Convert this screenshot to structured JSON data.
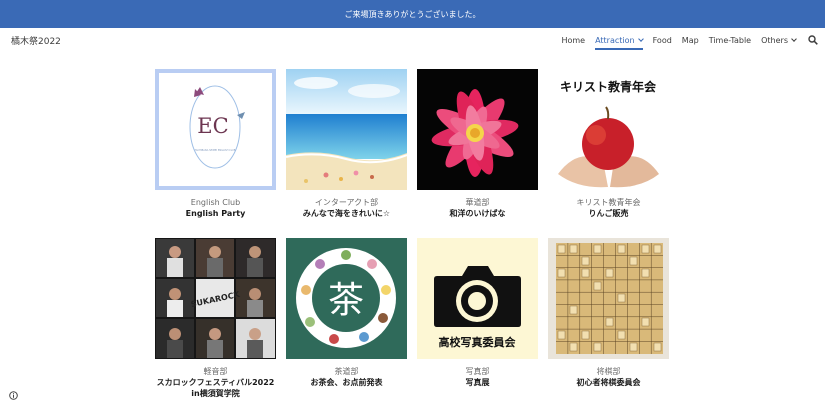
{
  "banner": {
    "text": "ご来場頂きありがとうございました。"
  },
  "header": {
    "site_title": "橘木祭2022",
    "nav": [
      {
        "label": "Home"
      },
      {
        "label": "Attraction"
      },
      {
        "label": "Food"
      },
      {
        "label": "Map"
      },
      {
        "label": "Time-Table"
      },
      {
        "label": "Others"
      }
    ]
  },
  "colors": {
    "accent": "#3a6ab6",
    "banner_bg": "#3a6ab6"
  },
  "tiles": [
    {
      "club": "English Club",
      "event": "English Party",
      "logo_text": "EC",
      "logo_caption": "TACHIBANA SEIMEI ENGLISH CLUB"
    },
    {
      "club": "インターアクト部",
      "event": "みんなで海をきれいに☆"
    },
    {
      "club": "華道部",
      "event": "和洋のいけばな"
    },
    {
      "club": "キリスト教青年会",
      "event": "りんご販売",
      "image_text": "キリスト教青年会"
    },
    {
      "club": "軽音部",
      "event": "スカロックフェスティバル2022",
      "event_line2": "in横須賀学院",
      "image_text": "SUKAROCK"
    },
    {
      "club": "茶道部",
      "event": "お茶会、お点前発表",
      "image_text": "茶"
    },
    {
      "club": "写真部",
      "event": "写真展",
      "image_text": "高校写真委員会"
    },
    {
      "club": "将棋部",
      "event": "初心者将棋委員会"
    }
  ],
  "icons": [
    "chevron-down-icon",
    "search-icon",
    "info-icon"
  ]
}
